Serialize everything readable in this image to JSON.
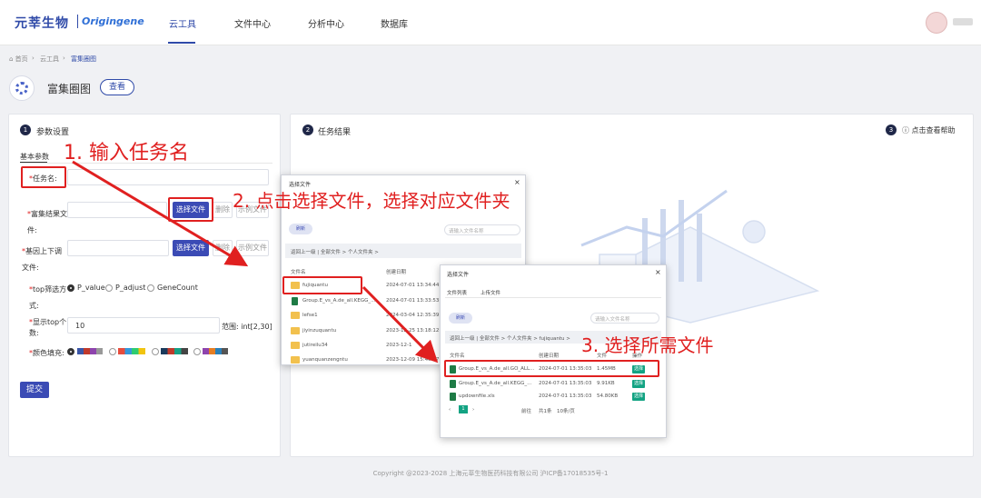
{
  "header": {
    "logo_cn": "元莘生物",
    "logo_en": "Origingene",
    "nav": [
      "云工具",
      "文件中心",
      "分析中心",
      "数据库"
    ]
  },
  "breadcrumb": [
    "首页",
    "云工具",
    "富集圈图"
  ],
  "tool": {
    "title": "富集圈图",
    "view_label": "查看"
  },
  "left_panel": {
    "step": "1",
    "title": "参数设置",
    "tab": "基本参数",
    "task_name_label": "任务名:",
    "enrich_file_label": "富集结果文件:",
    "gene_file_label": "基因上下调文件:",
    "select_file_label": "选择文件",
    "delete_label": "删除",
    "example_label": "示例文件",
    "top_filter_label": "top筛选方式:",
    "top_options": [
      "P_value",
      "P_adjust",
      "GeneCount"
    ],
    "top_count_label": "显示top个数:",
    "top_count_value": "10",
    "range_text": "范围: int[2,30]",
    "color_fill_label": "颜色填充:",
    "submit_label": "提交"
  },
  "right_panel": {
    "step": "2",
    "title": "任务结果",
    "help_step": "3",
    "help_label": "点击查看帮助"
  },
  "dialog1": {
    "title": "选择文件",
    "refresh": "刷新",
    "search_placeholder": "请输入文件名称",
    "path": "返回上一级 | 全部文件 > 个人文件夹 >",
    "col_name": "文件名",
    "col_date": "创建日期",
    "rows": [
      {
        "name": "fujiquantu",
        "date": "2024-07-01 13:34:44",
        "type": "folder"
      },
      {
        "name": "Group.E_vs_A.de_all.KEGG_...",
        "date": "2024-07-01 13:33:53",
        "type": "xls"
      },
      {
        "name": "lefse1",
        "date": "2024-03-04 12:35:39",
        "type": "folder"
      },
      {
        "name": "jiyinzuquantu",
        "date": "2023-12-25 13:18:12",
        "type": "folder"
      },
      {
        "name": "jutireilu34",
        "date": "2023-12-1",
        "type": "folder"
      },
      {
        "name": "yuanquanzengntu",
        "date": "2023-12-09 15:40:27",
        "type": "folder"
      }
    ]
  },
  "dialog2": {
    "title": "选择文件",
    "tabs": [
      "文件列表",
      "上传文件"
    ],
    "refresh": "刷新",
    "search_placeholder": "请输入文件名称",
    "path": "返回上一级 | 全部文件 > 个人文件夹 > fujiquantu >",
    "col_name": "文件名",
    "col_date": "创建日期",
    "col_size": "文件",
    "col_action": "操作",
    "pick_label": "选择",
    "rows": [
      {
        "name": "Group.E_vs_A.de_all.GO_ALL...",
        "date": "2024-07-01 13:35:03",
        "size": "1.45MB"
      },
      {
        "name": "Group.E_vs_A.de_all.KEGG_...",
        "date": "2024-07-01 13:35:03",
        "size": "9.91KB"
      },
      {
        "name": "updownfile.xls",
        "date": "2024-07-01 13:35:03",
        "size": "54.80KB"
      }
    ],
    "pager": {
      "current": "1",
      "goto": "前往",
      "page": "共1条",
      "per_page": "10条/页"
    }
  },
  "annotations": {
    "step1": "1. 输入任务名",
    "step2": "2. 点击选择文件，选择对应文件夹",
    "step3": "3. 选择所需文件"
  },
  "footer": "Copyright @2023-2028 上海元莘生物医药科技有限公司 沪ICP备17018535号-1",
  "colors": {
    "primary": "#3b4bb5",
    "annotation": "#e02020",
    "pick": "#13a383"
  }
}
